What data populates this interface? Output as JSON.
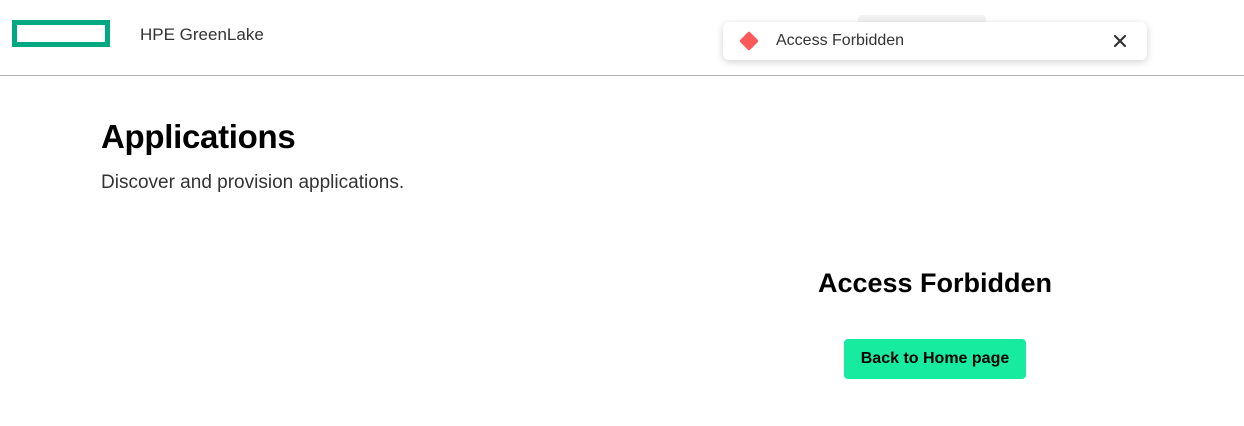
{
  "header": {
    "brand": "HPE GreenLake",
    "logo_icon": "hpe-element-logo",
    "logo_color": "#01a982"
  },
  "toast": {
    "status": "critical",
    "status_icon": "critical-diamond-icon",
    "status_color": "#fc5a5a",
    "message": "Access Forbidden",
    "close_icon": "close-icon"
  },
  "page": {
    "title": "Applications",
    "subtitle": "Discover and provision applications."
  },
  "error": {
    "title": "Access Forbidden",
    "button_label": "Back to Home page",
    "button_color": "#17eba0"
  }
}
